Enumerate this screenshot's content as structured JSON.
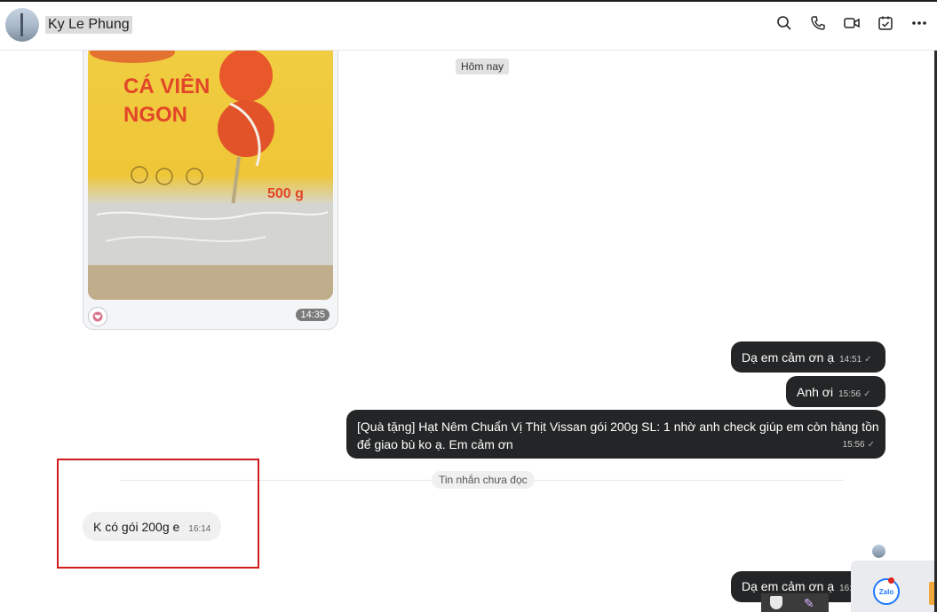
{
  "header": {
    "contact_name": "Ky Le Phung",
    "icons": [
      "search-icon",
      "phone-icon",
      "video-call-icon",
      "task-icon",
      "more-icon"
    ]
  },
  "chat": {
    "date_label": "Hôm nay",
    "photo_card": {
      "product_text": [
        "CÁ VIÊN",
        "NGON"
      ],
      "weight": "500 g",
      "time": "14:35",
      "reaction": "heart-icon"
    },
    "outgoing": [
      {
        "text": "Dạ em cảm ơn ạ",
        "time": "14:51"
      },
      {
        "text": "Anh ơi",
        "time": "15:56"
      },
      {
        "text": "[Quà tặng] Hạt Nêm Chuẩn Vị Thịt Vissan gói 200g SL: 1 nhờ anh check giúp em còn hàng tồn để giao bù ko ạ. Em cảm ơn",
        "time": "15:56"
      },
      {
        "text": "Dạ em cảm ơn ạ",
        "time": "16:"
      }
    ],
    "unread_divider": "Tin nhắn chưa đọc",
    "incoming": [
      {
        "text": "K có gói 200g e",
        "time": "16:14"
      }
    ]
  },
  "tray": {
    "app_label": "Zalo"
  },
  "colors": {
    "outgoing_bubble": "#242526",
    "incoming_bubble": "#f0f0f0",
    "highlight_box": "#d01c1c"
  }
}
